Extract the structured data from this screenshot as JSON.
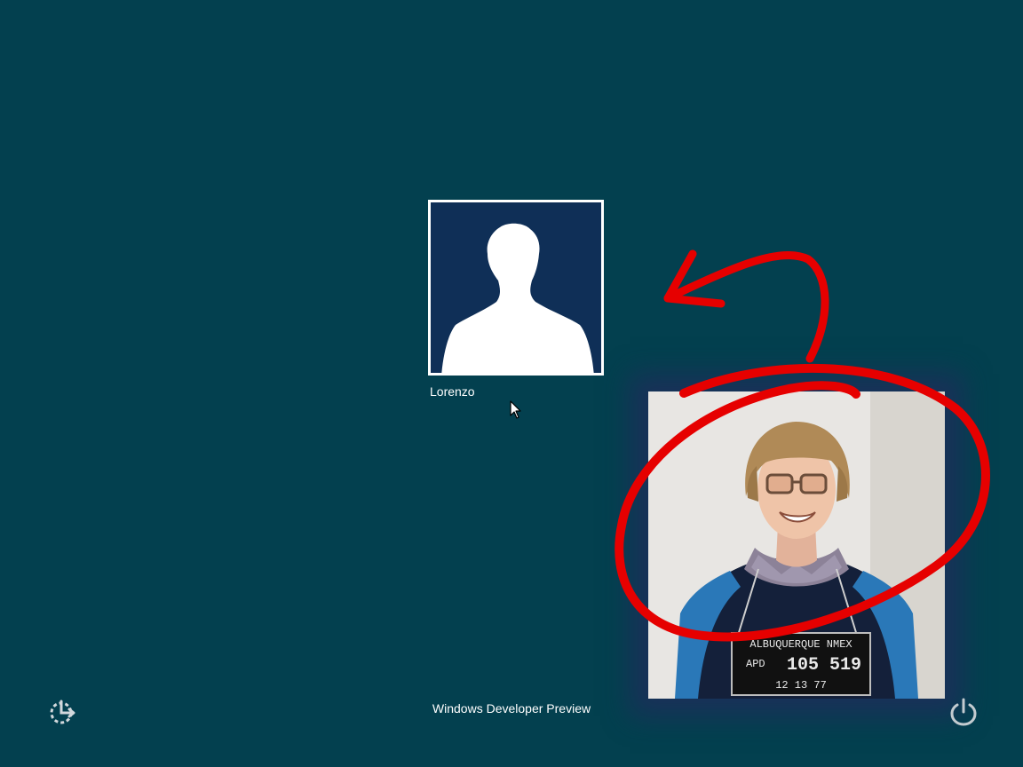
{
  "lock_screen": {
    "user": {
      "name": "Lorenzo",
      "avatar_icon": "user-silhouette-icon"
    },
    "footer": {
      "brand_text": "Windows Developer Preview"
    },
    "buttons": {
      "ease_of_access_icon": "ease-of-access-icon",
      "power_icon": "power-icon"
    }
  },
  "overlay_photo": {
    "placard_line1": "ALBUQUERQUE NMEX",
    "placard_line2_prefix": "APD",
    "placard_number": "105 519",
    "placard_date": "12 13 77"
  },
  "annotation": {
    "color": "#e60000",
    "shapes": [
      "circle-scribble",
      "curved-arrow"
    ]
  },
  "colors": {
    "background": "#03404f",
    "avatar_background": "#0f2f57",
    "text": "#ffffff"
  }
}
